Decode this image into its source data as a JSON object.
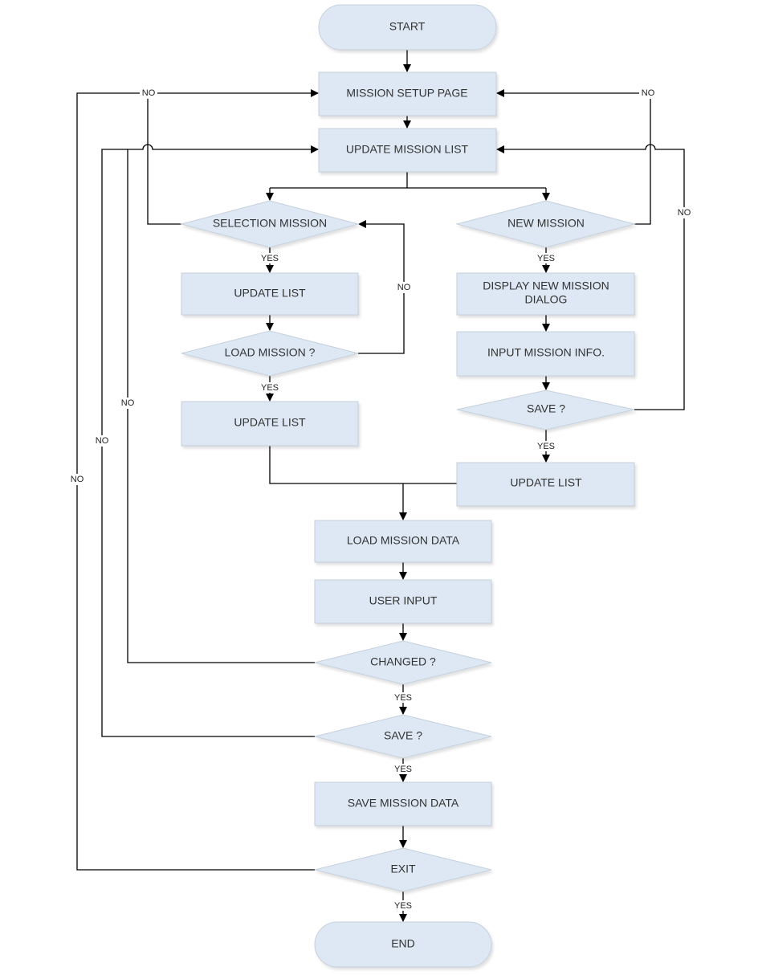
{
  "nodes": {
    "start": "START",
    "mission_setup_page": "MISSION SETUP PAGE",
    "update_mission_list": "UPDATE MISSION LIST",
    "selection_mission": "SELECTION MISSION",
    "new_mission": "NEW MISSION",
    "update_list_1": "UPDATE LIST",
    "load_mission": "LOAD MISSION ?",
    "update_list_2": "UPDATE LIST",
    "display_dialog_line1": "DISPLAY NEW MISSION",
    "display_dialog_line2": "DIALOG",
    "input_mission_info": "INPUT MISSION INFO.",
    "save_new": "SAVE ?",
    "update_list_3": "UPDATE LIST",
    "load_mission_data": "LOAD MISSION DATA",
    "user_input": "USER INPUT",
    "changed": "CHANGED ?",
    "save": "SAVE ?",
    "save_mission_data": "SAVE MISSION DATA",
    "exit": "EXIT",
    "end": "END"
  },
  "edge_labels": {
    "yes": "YES",
    "no": "NO"
  },
  "colors": {
    "node_fill": "#dde8f4",
    "node_border": "#c5d0dc",
    "connector": "#000000"
  }
}
